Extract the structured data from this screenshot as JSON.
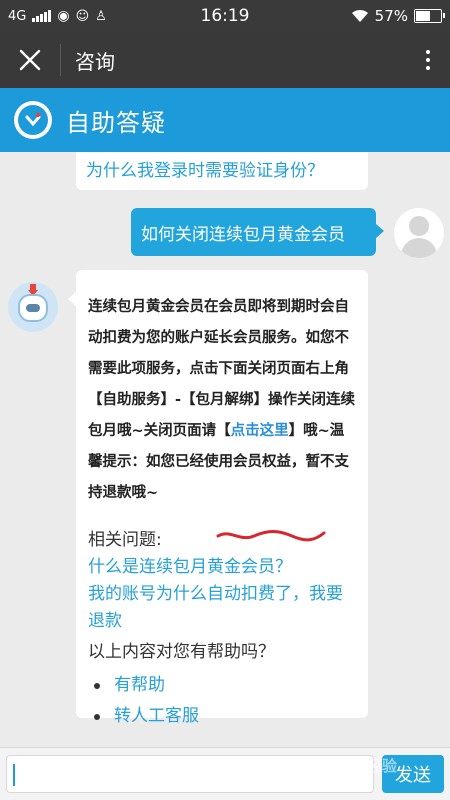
{
  "status_bar": {
    "network": "4G",
    "time": "16:19",
    "battery": "57%",
    "battery_level": 0.57
  },
  "app_bar": {
    "title": "咨询"
  },
  "header": {
    "title": "自助答疑"
  },
  "chat": {
    "prev_question": "为什么我登录时需要验证身份？",
    "user_message": "如何关闭连续包月黄金会员",
    "answer": {
      "part1": "连续包月黄金会员在会员即将到期时会自动扣费为您的账户延长会员服务。如您不需要此项服务，点击下面关闭页面右上角【自助服务】-【包月解绑】操作关闭连续包月哦~关闭页面请【",
      "link": "点击这里",
      "part2": "】哦~温馨提示：如您已经使用会员权益，暂不支持退款哦~"
    },
    "related_header": "相关问题:",
    "related_questions": [
      "什么是连续包月黄金会员？",
      "我的账号为什么自动扣费了，我要退款"
    ],
    "helpful_prompt": "以上内容对您有帮助吗？",
    "helpful_options": [
      "有帮助",
      "转人工客服"
    ]
  },
  "input_bar": {
    "send_label": "发送"
  },
  "watermark": "Bai 经验",
  "colors": {
    "accent": "#1c9ad9",
    "link": "#25a0d8",
    "dark_bar": "#393939"
  }
}
